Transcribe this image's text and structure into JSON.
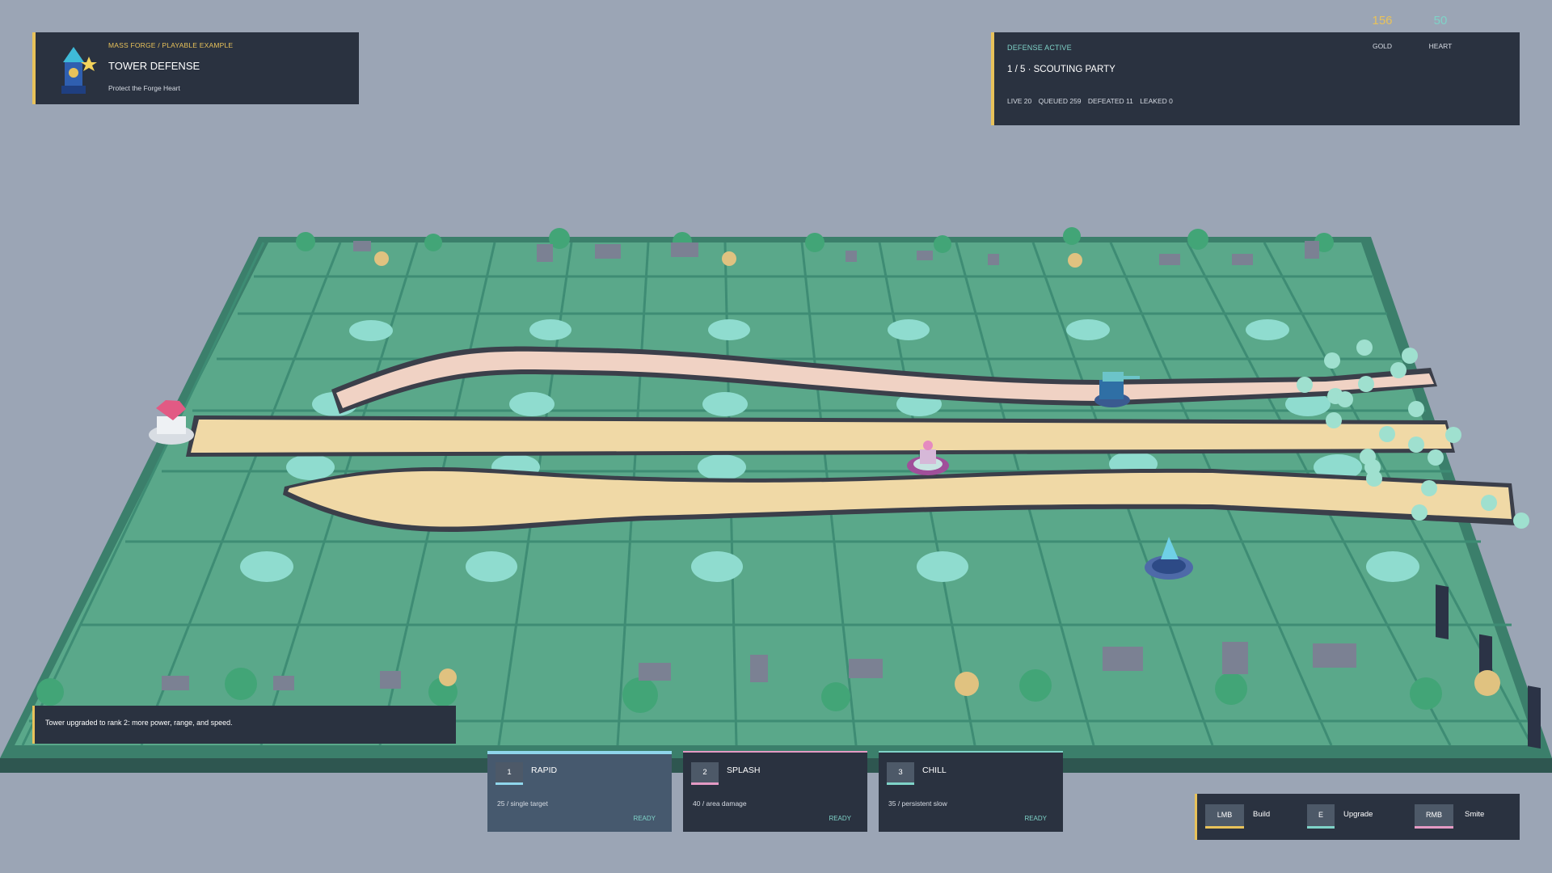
{
  "title_panel": {
    "breadcrumb": "MASS FORGE  /  PLAYABLE EXAMPLE",
    "title": "TOWER DEFENSE",
    "subtitle": "Protect the Forge Heart",
    "icon": "tower-icon"
  },
  "wave_panel": {
    "status": "DEFENSE ACTIVE",
    "title": "1 / 5 · SCOUTING PARTY",
    "stats": {
      "live": "LIVE 20",
      "queued": "QUEUED 259",
      "defeated": "DEFEATED 11",
      "leaked": "LEAKED 0"
    },
    "gold": {
      "value": "156",
      "label": "GOLD",
      "color": "#e8c25a"
    },
    "heart": {
      "value": "50",
      "label": "HEART",
      "color": "#7fd3c8"
    }
  },
  "message": "Tower upgraded to rank 2: more power, range, and speed.",
  "tower_cards": [
    {
      "key": "1",
      "name": "RAPID",
      "desc": "25  /  single target",
      "state": "READY",
      "color": "#8fd6ec"
    },
    {
      "key": "2",
      "name": "SPLASH",
      "desc": "40  /  area damage",
      "state": "READY",
      "color": "#e49ac4"
    },
    {
      "key": "3",
      "name": "CHILL",
      "desc": "35  /  persistent slow",
      "state": "READY",
      "color": "#7fd3c8"
    }
  ],
  "controls": [
    {
      "key": "LMB",
      "label": "Build",
      "color": "#e8c25a"
    },
    {
      "key": "E",
      "label": "Upgrade",
      "color": "#7fd3c8"
    },
    {
      "key": "RMB",
      "label": "Smite",
      "color": "#e49ac4"
    }
  ],
  "colors": {
    "accent": "#e8c25a",
    "panel": "#2a3240",
    "board_tile": "#5aa88a",
    "path": "#f0d9a6",
    "build_slot": "#8fdccf"
  }
}
